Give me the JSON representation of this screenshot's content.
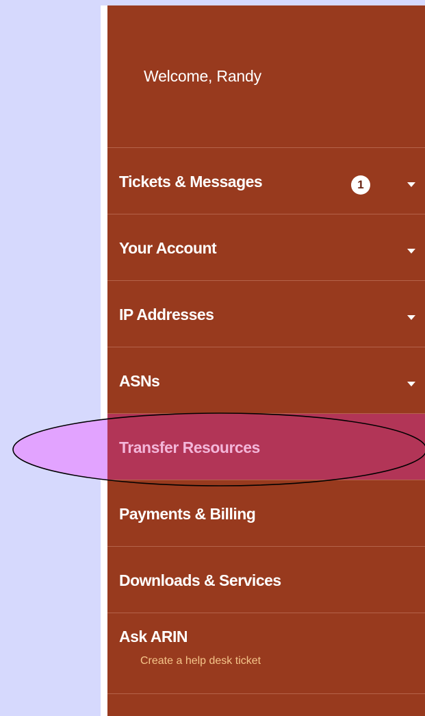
{
  "welcome": {
    "text": "Welcome, Randy"
  },
  "menu": {
    "items": [
      {
        "id": "tickets",
        "label": "Tickets & Messages",
        "badge": "1",
        "has_dropdown": true
      },
      {
        "id": "account",
        "label": "Your Account",
        "has_dropdown": true
      },
      {
        "id": "ip",
        "label": "IP Addresses",
        "has_dropdown": true
      },
      {
        "id": "asns",
        "label": "ASNs",
        "has_dropdown": true
      },
      {
        "id": "transfer",
        "label": "Transfer Resources",
        "highlighted": true
      },
      {
        "id": "payments",
        "label": "Payments & Billing"
      },
      {
        "id": "downloads",
        "label": "Downloads & Services"
      }
    ],
    "ask": {
      "label": "Ask ARIN",
      "sublabel": "Create a help desk ticket"
    }
  },
  "colors": {
    "background": "#d6d9fd",
    "sidebar": "#983a1e",
    "divider": "#b5634b",
    "highlight_fill": "#b23557",
    "highlight_text": "#f3b6d9",
    "ellipse_fill": "#e2a3ff",
    "sublabel": "#f5c58a"
  },
  "icons": {
    "dropdown": "caret-down-icon",
    "badge": "notification-badge"
  }
}
